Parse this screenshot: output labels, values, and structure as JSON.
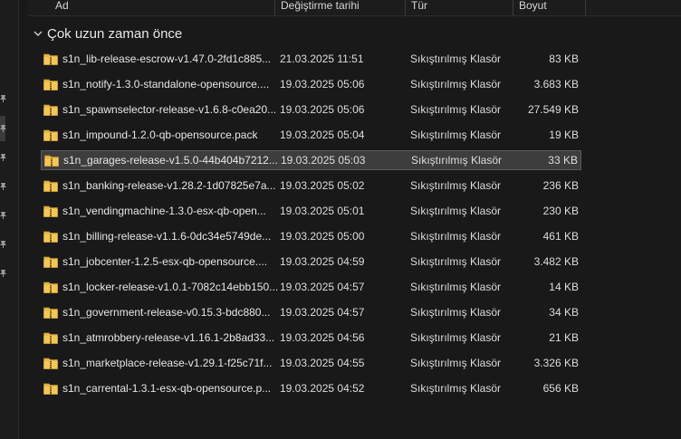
{
  "columns": {
    "name": "Ad",
    "date": "Değiştirme tarihi",
    "type": "Tür",
    "size": "Boyut"
  },
  "group": {
    "label": "Çok uzun zaman önce"
  },
  "files": [
    {
      "name": "s1n_lib-release-escrow-v1.47.0-2fd1c885...",
      "date": "21.03.2025 11:51",
      "type": "Sıkıştırılmış Klasör",
      "size": "83 KB"
    },
    {
      "name": "s1n_notify-1.3.0-standalone-opensource....",
      "date": "19.03.2025 05:06",
      "type": "Sıkıştırılmış Klasör",
      "size": "3.683 KB"
    },
    {
      "name": "s1n_spawnselector-release-v1.6.8-c0ea20...",
      "date": "19.03.2025 05:06",
      "type": "Sıkıştırılmış Klasör",
      "size": "27.549 KB"
    },
    {
      "name": "s1n_impound-1.2.0-qb-opensource.pack",
      "date": "19.03.2025 05:04",
      "type": "Sıkıştırılmış Klasör",
      "size": "19 KB"
    },
    {
      "name": "s1n_garages-release-v1.5.0-44b404b7212...",
      "date": "19.03.2025 05:03",
      "type": "Sıkıştırılmış Klasör",
      "size": "33 KB",
      "selected": true
    },
    {
      "name": "s1n_banking-release-v1.28.2-1d07825e7a...",
      "date": "19.03.2025 05:02",
      "type": "Sıkıştırılmış Klasör",
      "size": "236 KB"
    },
    {
      "name": "s1n_vendingmachine-1.3.0-esx-qb-open...",
      "date": "19.03.2025 05:01",
      "type": "Sıkıştırılmış Klasör",
      "size": "230 KB"
    },
    {
      "name": "s1n_billing-release-v1.1.6-0dc34e5749de...",
      "date": "19.03.2025 05:00",
      "type": "Sıkıştırılmış Klasör",
      "size": "461 KB"
    },
    {
      "name": "s1n_jobcenter-1.2.5-esx-qb-opensource....",
      "date": "19.03.2025 04:59",
      "type": "Sıkıştırılmış Klasör",
      "size": "3.482 KB"
    },
    {
      "name": "s1n_locker-release-v1.0.1-7082c14ebb150...",
      "date": "19.03.2025 04:57",
      "type": "Sıkıştırılmış Klasör",
      "size": "14 KB"
    },
    {
      "name": "s1n_government-release-v0.15.3-bdc880...",
      "date": "19.03.2025 04:57",
      "type": "Sıkıştırılmış Klasör",
      "size": "34 KB"
    },
    {
      "name": "s1n_atmrobbery-release-v1.16.1-2b8ad33...",
      "date": "19.03.2025 04:56",
      "type": "Sıkıştırılmış Klasör",
      "size": "21 KB"
    },
    {
      "name": "s1n_marketplace-release-v1.29.1-f25c71f...",
      "date": "19.03.2025 04:55",
      "type": "Sıkıştırılmış Klasör",
      "size": "3.326 KB"
    },
    {
      "name": "s1n_carrental-1.3.1-esx-qb-opensource.p...",
      "date": "19.03.2025 04:52",
      "type": "Sıkıştırılmış Klasör",
      "size": "656 KB"
    }
  ],
  "colors": {
    "background": "#191919",
    "selection": "#3d3d3d",
    "zip_folder": "#e8b84a"
  },
  "icons": {
    "file": "zip-folder-icon",
    "group_toggle": "chevron-down-icon",
    "pin": "pin-icon"
  }
}
